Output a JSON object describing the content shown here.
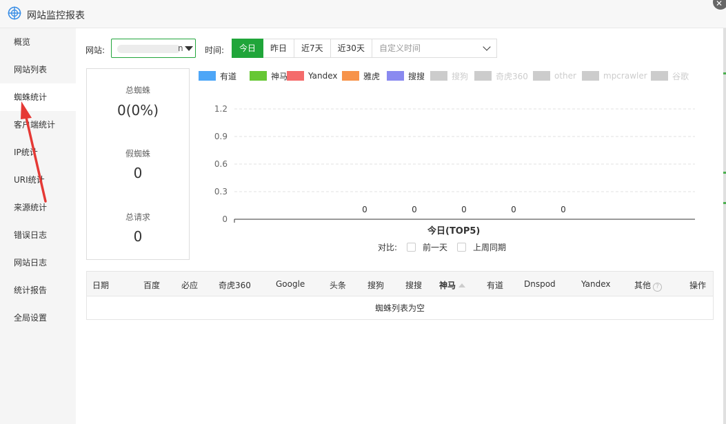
{
  "window": {
    "title": "网站监控报表"
  },
  "sidebar": {
    "items": [
      {
        "label": "概览"
      },
      {
        "label": "网站列表"
      },
      {
        "label": "蜘蛛统计"
      },
      {
        "label": "客户端统计"
      },
      {
        "label": "IP统计"
      },
      {
        "label": "URI统计"
      },
      {
        "label": "来源统计"
      },
      {
        "label": "错误日志"
      },
      {
        "label": "网站日志"
      },
      {
        "label": "统计报告"
      },
      {
        "label": "全局设置"
      }
    ],
    "active_index": 2
  },
  "toolbar": {
    "site_label": "网站:",
    "site_value_suffix": "n",
    "time_label": "时间:",
    "tabs": [
      "今日",
      "昨日",
      "近7天",
      "近30天"
    ],
    "active_tab": "今日",
    "custom_time_placeholder": "自定义时间"
  },
  "stats": {
    "total_spider_label": "总蜘蛛",
    "total_spider_value": "0(0%)",
    "fake_spider_label": "假蜘蛛",
    "fake_spider_value": "0",
    "total_requests_label": "总请求",
    "total_requests_value": "0"
  },
  "legend": [
    {
      "name": "有道",
      "color": "#4da6f7",
      "active": true
    },
    {
      "name": "神马",
      "color": "#66c734",
      "active": true
    },
    {
      "name": "Yandex",
      "color": "#f46b6b",
      "active": true
    },
    {
      "name": "雅虎",
      "color": "#f7934a",
      "active": true
    },
    {
      "name": "搜搜",
      "color": "#8a8af0",
      "active": true
    },
    {
      "name": "搜狗",
      "color": "#cccccc",
      "active": false
    },
    {
      "name": "奇虎360",
      "color": "#cccccc",
      "active": false
    },
    {
      "name": "other",
      "color": "#cccccc",
      "active": false
    },
    {
      "name": "mpcrawler",
      "color": "#cccccc",
      "active": false
    },
    {
      "name": "谷歌",
      "color": "#cccccc",
      "active": false
    }
  ],
  "chart_data": {
    "type": "bar",
    "title": "今日(TOP5)",
    "categories": [
      "",
      "",
      "",
      "",
      ""
    ],
    "values": [
      0,
      0,
      0,
      0,
      0
    ],
    "data_labels": [
      "0",
      "0",
      "0",
      "0",
      "0"
    ],
    "y_ticks": [
      "0",
      "0.3",
      "0.6",
      "0.9",
      "1.2"
    ],
    "ylim": [
      0,
      1.2
    ],
    "grid": true,
    "legend_position": "top"
  },
  "compare": {
    "label": "对比:",
    "options": [
      "前一天",
      "上周同期"
    ]
  },
  "table": {
    "columns": [
      "日期",
      "百度",
      "必应",
      "奇虎360",
      "Google",
      "头条",
      "搜狗",
      "搜搜",
      "神马",
      "有道",
      "Dnspod",
      "Yandex",
      "其他",
      "操作"
    ],
    "sorted_column": "神马",
    "empty_text": "蜘蛛列表为空"
  }
}
